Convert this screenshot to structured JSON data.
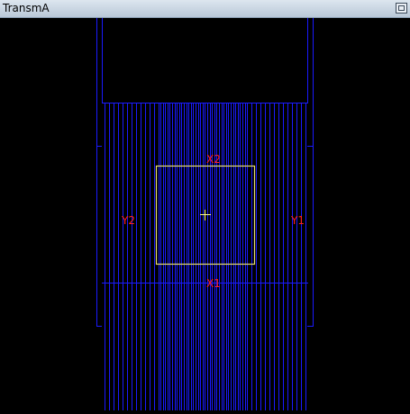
{
  "window": {
    "title": "TransmA"
  },
  "field_labels": {
    "x1": "X1",
    "x2": "X2",
    "y1": "Y1",
    "y2": "Y2"
  },
  "colors": {
    "background": "#000000",
    "leaves": "#1a1aff",
    "field_box": "#e8e070",
    "labels": "#ff2020",
    "crosshair": "#ffff88"
  },
  "icons": {
    "window_button": "restore-icon"
  }
}
